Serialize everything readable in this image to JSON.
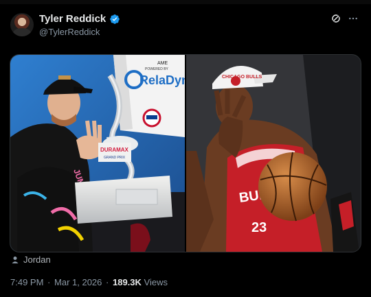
{
  "post": {
    "author_name": "Tyler Reddick",
    "handle": "@TylerReddick",
    "time": "7:49 PM",
    "separator": "·",
    "date": "Mar 1, 2026",
    "views_count": "189.3K",
    "views_label": "Views",
    "caption": "Jordan"
  },
  "icons": {
    "verified": "verified-badge-icon",
    "grok": "grok-icon",
    "more": "more-options-icon",
    "person": "person-icon"
  },
  "colors": {
    "background": "#000000",
    "verified": "#1d9bf0",
    "muted": "#8b98a5",
    "text": "#e7e9ea"
  },
  "media": {
    "left_image": {
      "banner_powered": "POWERED BY",
      "banner_brand": "RelaDyne",
      "banner_top_text": "AME",
      "trophy_text": "DURAMAX",
      "trophy_subtext": "GRAND PRIX",
      "suit_text": "JUMP CASH"
    },
    "right_image": {
      "cap_text": "CHICAGO BULLS",
      "jersey_text": "BULLS",
      "jersey_number": "23"
    }
  }
}
